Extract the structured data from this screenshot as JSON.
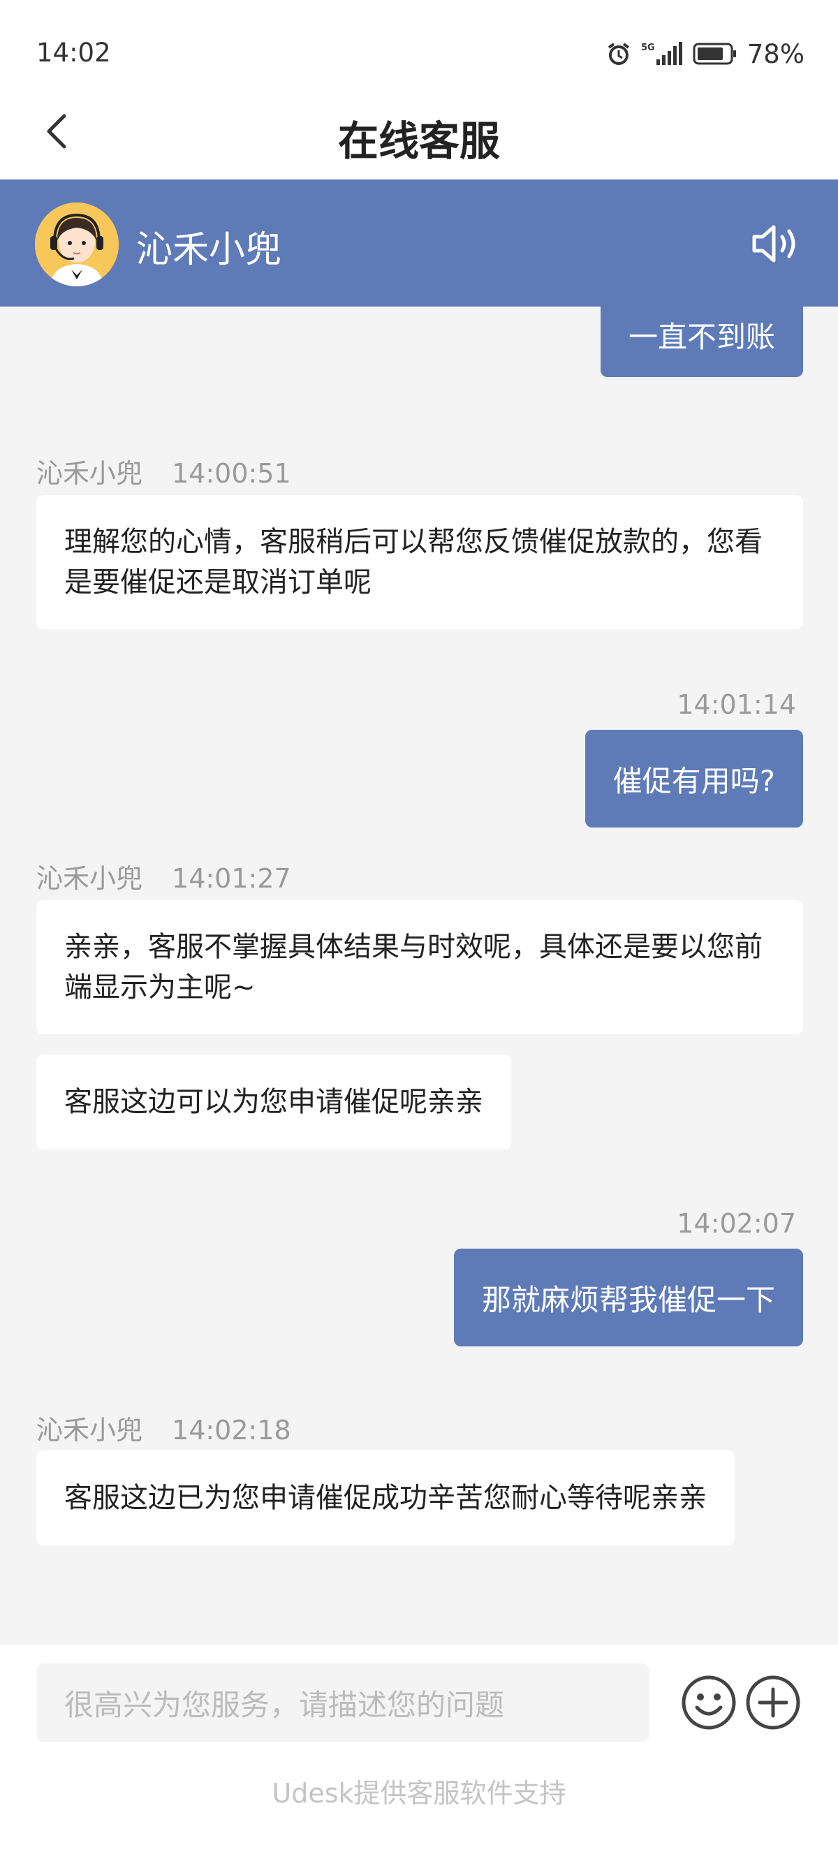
{
  "status_bar": {
    "time": "14:02",
    "network": "5G",
    "battery": "78%",
    "icons": [
      "alarm-icon",
      "signal-icon",
      "battery-icon"
    ]
  },
  "nav": {
    "title": "在线客服",
    "back_icon": "chevron-left-icon"
  },
  "agent": {
    "name": "沁禾小兜",
    "avatar_icon": "agent-avatar",
    "speaker_icon": "speaker-icon",
    "accent_color": "#5e7bb8"
  },
  "messages": [
    {
      "from": "user",
      "text": "一直不到账"
    },
    {
      "from": "agent",
      "sender": "沁禾小兜",
      "time": "14:00:51",
      "text": "理解您的心情，客服稍后可以帮您反馈催促放款的，您看是要催促还是取消订单呢"
    },
    {
      "from": "user",
      "time": "14:01:14",
      "text": "催促有用吗?"
    },
    {
      "from": "agent",
      "sender": "沁禾小兜",
      "time": "14:01:27",
      "text": "亲亲，客服不掌握具体结果与时效呢，具体还是要以您前端显示为主呢~"
    },
    {
      "from": "agent",
      "text": "客服这边可以为您申请催促呢亲亲"
    },
    {
      "from": "user",
      "time": "14:02:07",
      "text": "那就麻烦帮我催促一下"
    },
    {
      "from": "agent",
      "sender": "沁禾小兜",
      "time": "14:02:18",
      "text": "客服这边已为您申请催促成功辛苦您耐心等待呢亲亲"
    }
  ],
  "input": {
    "placeholder": "很高兴为您服务，请描述您的问题",
    "emoji_icon": "emoji-icon",
    "plus_icon": "plus-icon"
  },
  "footer": {
    "text": "Udesk提供客服软件支持"
  }
}
